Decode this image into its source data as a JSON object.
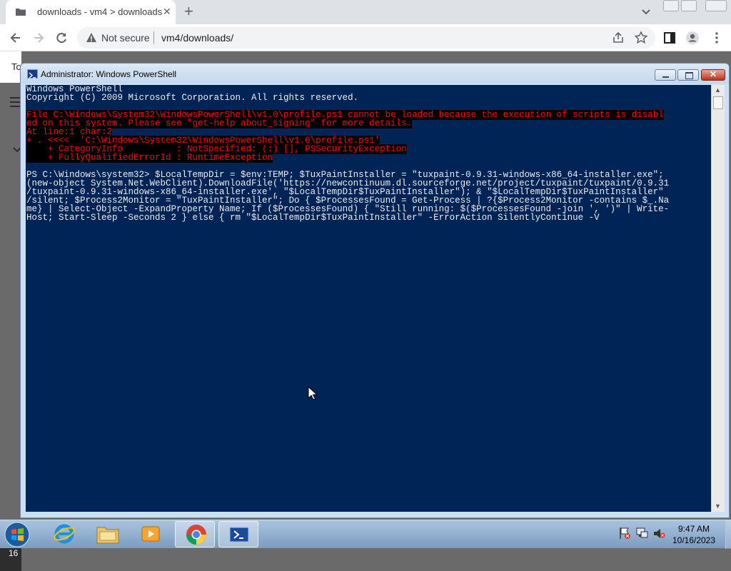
{
  "browser": {
    "tab_title": "downloads - vm4 > downloads",
    "security_label": "Not secure",
    "url": "vm4/downloads/",
    "page_left_text": "To",
    "page_left_number": "16"
  },
  "powershell": {
    "title": "Administrator: Windows PowerShell",
    "lines": [
      {
        "text": "Windows PowerShell",
        "kind": "normal"
      },
      {
        "text": "Copyright (C) 2009 Microsoft Corporation. All rights reserved.",
        "kind": "normal"
      },
      {
        "text": "",
        "kind": "blank"
      },
      {
        "text": "File C:\\Windows\\System32\\WindowsPowerShell\\v1.0\\profile.ps1 cannot be loaded because the execution of scripts is disabl",
        "kind": "error"
      },
      {
        "text": "ed on this system. Please see \"get-help about_signing\" for more details.",
        "kind": "error"
      },
      {
        "text": "At line:1 char:2",
        "kind": "error"
      },
      {
        "text": "+ . <<<<  'C:\\Windows\\System32\\WindowsPowerShell\\v1.0\\profile.ps1'",
        "kind": "error"
      },
      {
        "text": "    + CategoryInfo          : NotSpecified: (:) [], PSSecurityException",
        "kind": "error"
      },
      {
        "text": "    + FullyQualifiedErrorId : RuntimeException",
        "kind": "error"
      },
      {
        "text": "",
        "kind": "blank"
      },
      {
        "text": "PS C:\\Windows\\system32> $LocalTempDir = $env:TEMP; $TuxPaintInstaller = \"tuxpaint-0.9.31-windows-x86_64-installer.exe\";",
        "kind": "normal"
      },
      {
        "text": "(new-object System.Net.WebClient).DownloadFile('https://newcontinuum.dl.sourceforge.net/project/tuxpaint/tuxpaint/0.9.31",
        "kind": "normal"
      },
      {
        "text": "/tuxpaint-0.9.31-windows-x86_64-installer.exe', \"$LocalTempDir$TuxPaintInstaller\"); & \"$LocalTempDir$TuxPaintInstaller\"",
        "kind": "normal"
      },
      {
        "text": "/silent; $Process2Monitor = \"TuxPaintInstaller\"; Do { $ProcessesFound = Get-Process | ?{$Process2Monitor -contains $_.Na",
        "kind": "normal"
      },
      {
        "text": "me} | Select-Object -ExpandProperty Name; If ($ProcessesFound) { \"Still running: $($ProcessesFound -join ', ')\" | Write-",
        "kind": "normal"
      },
      {
        "text": "Host; Start-Sleep -Seconds 2 } else { rm \"$LocalTempDir$TuxPaintInstaller\" -ErrorAction SilentlyContinue -V",
        "kind": "normal"
      }
    ]
  },
  "taskbar": {
    "time": "9:47 AM",
    "date": "10/16/2023",
    "pinned": [
      "internet-explorer-icon",
      "explorer-folder-icon",
      "media-player-icon",
      "chrome-icon",
      "powershell-icon"
    ]
  },
  "colors": {
    "console_bg": "#012456",
    "console_fg": "#eeedf0",
    "error_fg": "#ff0000",
    "error_bg": "#000000"
  }
}
